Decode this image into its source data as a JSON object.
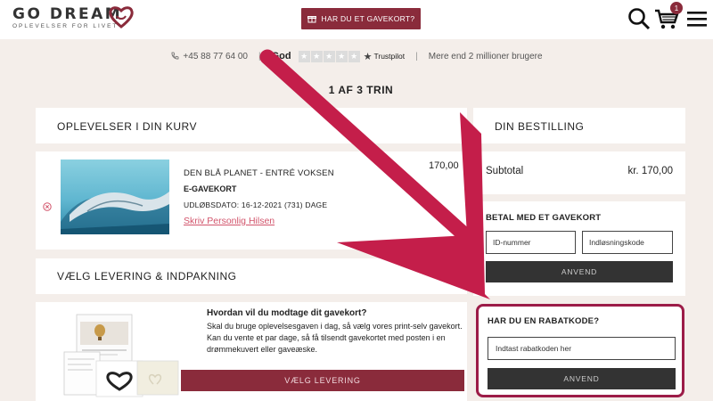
{
  "header": {
    "logo_name": "GO DREAM",
    "logo_tagline": "OPLEVELSER FOR LIVET",
    "gift_button": "HAR DU ET GAVEKORT?",
    "cart_count": "1"
  },
  "trustbar": {
    "phone": "+45 88 77 64 00",
    "rating_label": "God",
    "trustpilot": "Trustpilot",
    "users": "Mere end 2 millioner brugere"
  },
  "step": "1 AF 3 TRIN",
  "cart": {
    "title": "OPLEVELSER I DIN KURV",
    "item": {
      "name": "DEN BLÅ PLANET - ENTRÉ VOKSEN",
      "type": "E-GAVEKORT",
      "expiry": "UDLØBSDATO: 16-12-2021 (731) DAGE",
      "link": "Skriv Personlig Hilsen",
      "price": "170,00"
    }
  },
  "delivery": {
    "title": "VÆLG LEVERING & INDPAKNING",
    "question": "Hvordan vil du modtage dit gavekort?",
    "text": "Skal du bruge oplevelsesgaven i dag, så vælg vores print-selv gavekort. Kan du vente et par dage, så få tilsendt gavekortet med posten i en drømmekuvert eller gaveæske.",
    "button": "VÆLG LEVERING"
  },
  "order": {
    "title": "DIN BESTILLING",
    "subtotal_label": "Subtotal",
    "subtotal_value": "kr. 170,00"
  },
  "giftcard": {
    "title": "BETAL MED ET GAVEKORT",
    "id_placeholder": "ID-nummer",
    "code_placeholder": "Indløsningskode",
    "apply": "ANVEND"
  },
  "discount": {
    "title": "HAR DU EN RABATKODE?",
    "placeholder": "Indtast rabatkoden her",
    "apply": "ANVEND"
  },
  "colors": {
    "brand": "#8a2b3b",
    "highlight": "#9c1c48",
    "arrow": "#c41e4a"
  }
}
